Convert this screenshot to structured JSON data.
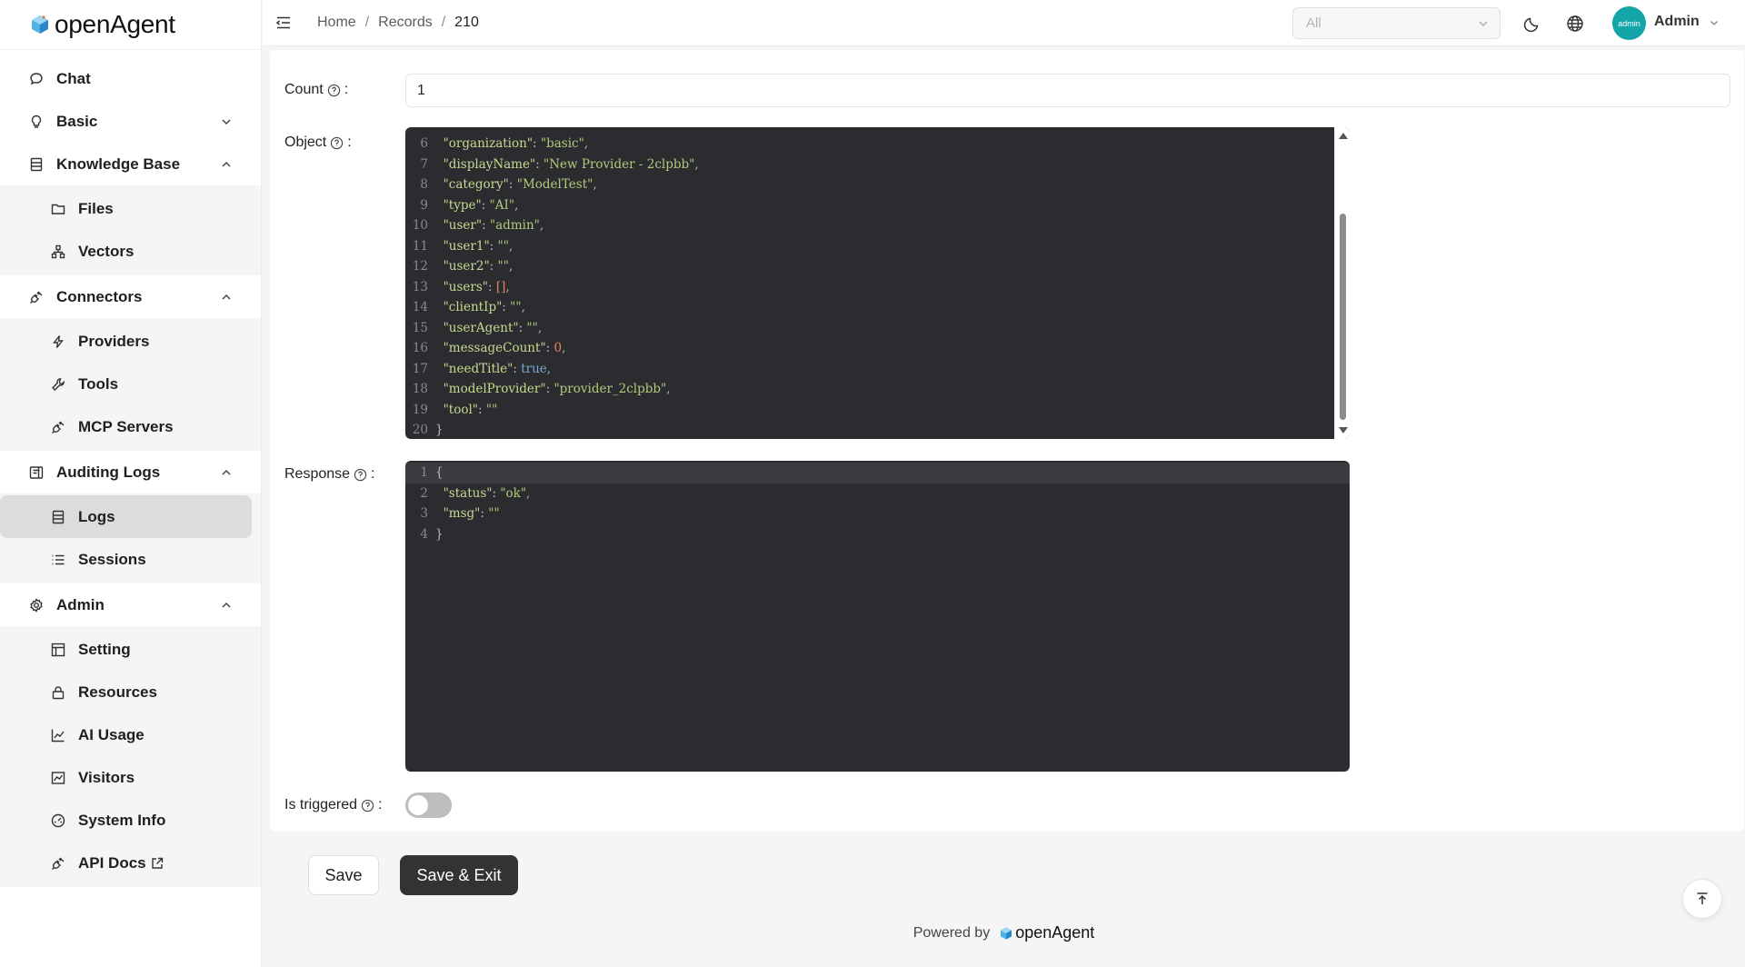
{
  "app": {
    "name": "openAgent"
  },
  "sidebar": {
    "items": [
      {
        "label": "Chat",
        "icon": "chat-icon"
      },
      {
        "label": "Basic",
        "icon": "bulb-icon"
      },
      {
        "label": "Knowledge Base",
        "icon": "database-icon",
        "children": [
          {
            "label": "Files",
            "icon": "folder-icon"
          },
          {
            "label": "Vectors",
            "icon": "nodes-icon"
          }
        ]
      },
      {
        "label": "Connectors",
        "icon": "plug-icon",
        "children": [
          {
            "label": "Providers",
            "icon": "bolt-icon"
          },
          {
            "label": "Tools",
            "icon": "wrench-icon"
          },
          {
            "label": "MCP Servers",
            "icon": "plug-icon"
          }
        ]
      },
      {
        "label": "Auditing Logs",
        "icon": "audit-icon",
        "children": [
          {
            "label": "Logs",
            "icon": "log-icon"
          },
          {
            "label": "Sessions",
            "icon": "list-icon"
          }
        ]
      },
      {
        "label": "Admin",
        "icon": "gear-icon",
        "children": [
          {
            "label": "Setting",
            "icon": "layout-icon"
          },
          {
            "label": "Resources",
            "icon": "lock-icon"
          },
          {
            "label": "AI Usage",
            "icon": "line-chart-icon"
          },
          {
            "label": "Visitors",
            "icon": "area-chart-icon"
          },
          {
            "label": "System Info",
            "icon": "dashboard-icon"
          },
          {
            "label": "API Docs",
            "icon": "plug-icon"
          }
        ]
      }
    ]
  },
  "header": {
    "breadcrumb": [
      "Home",
      "Records",
      "210"
    ],
    "org_select": "All",
    "avatar_text": "admin",
    "user_name": "Admin"
  },
  "form": {
    "count_label": "Count",
    "count_value": "1",
    "object_label": "Object",
    "response_label": "Response",
    "triggered_label": "Is triggered",
    "triggered": false,
    "colon": ":"
  },
  "object_lines": [
    {
      "n": "6",
      "key": "\"organization\"",
      "val": "\"basic\"",
      "type": "s"
    },
    {
      "n": "7",
      "key": "\"displayName\"",
      "val": "\"New Provider - 2clpbb\"",
      "type": "s"
    },
    {
      "n": "8",
      "key": "\"category\"",
      "val": "\"ModelTest\"",
      "type": "s"
    },
    {
      "n": "9",
      "key": "\"type\"",
      "val": "\"AI\"",
      "type": "s"
    },
    {
      "n": "10",
      "key": "\"user\"",
      "val": "\"admin\"",
      "type": "s"
    },
    {
      "n": "11",
      "key": "\"user1\"",
      "val": "\"\"",
      "type": "s"
    },
    {
      "n": "12",
      "key": "\"user2\"",
      "val": "\"\"",
      "type": "s"
    },
    {
      "n": "13",
      "key": "\"users\"",
      "val": "[]",
      "type": "n"
    },
    {
      "n": "14",
      "key": "\"clientIp\"",
      "val": "\"\"",
      "type": "s"
    },
    {
      "n": "15",
      "key": "\"userAgent\"",
      "val": "\"\"",
      "type": "s"
    },
    {
      "n": "16",
      "key": "\"messageCount\"",
      "val": "0",
      "type": "n"
    },
    {
      "n": "17",
      "key": "\"needTitle\"",
      "val": "true",
      "type": "b"
    },
    {
      "n": "18",
      "key": "\"modelProvider\"",
      "val": "\"provider_2clpbb\"",
      "type": "s"
    },
    {
      "n": "19",
      "key": "\"tool\"",
      "val": "\"\"",
      "type": "s",
      "last": true
    },
    {
      "n": "20",
      "brace": "}"
    }
  ],
  "response_lines": [
    {
      "n": "1",
      "brace": "{"
    },
    {
      "n": "2",
      "key": "\"status\"",
      "val": "\"ok\"",
      "type": "s"
    },
    {
      "n": "3",
      "key": "\"msg\"",
      "val": "\"\"",
      "type": "s",
      "last": true
    },
    {
      "n": "4",
      "brace": "}"
    }
  ],
  "buttons": {
    "save": "Save",
    "save_exit": "Save & Exit"
  },
  "footer": {
    "powered_by": "Powered by",
    "brand": "openAgent"
  }
}
